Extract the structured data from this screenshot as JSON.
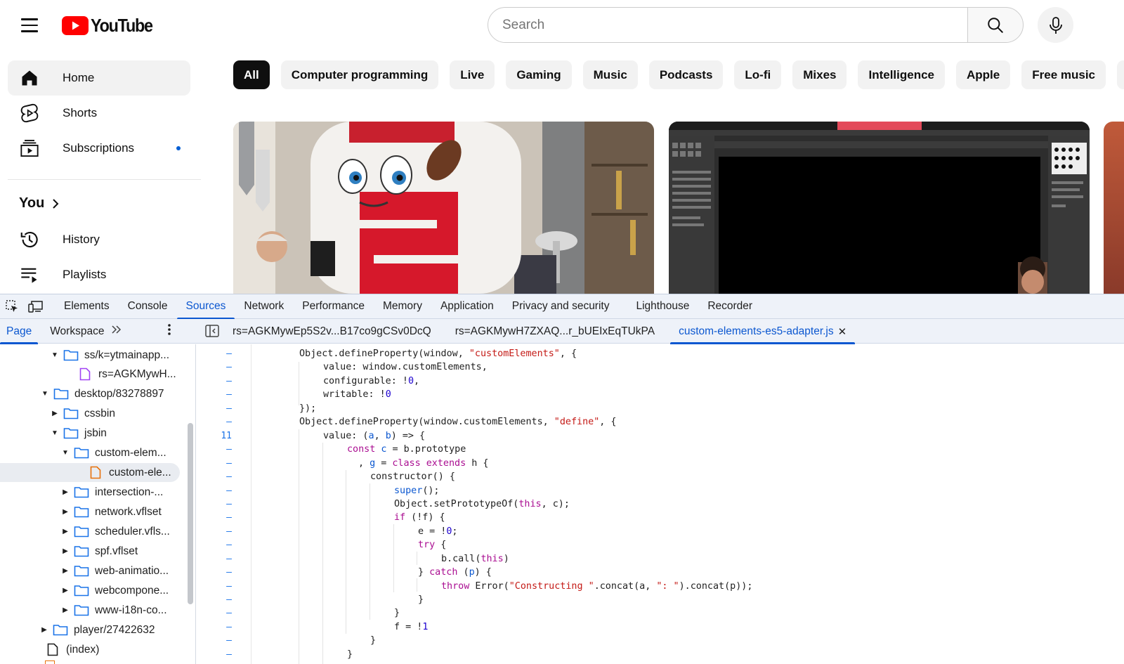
{
  "youtube": {
    "logo_text": "YouTube",
    "search": {
      "placeholder": "Search",
      "value": ""
    },
    "sidebar": {
      "items": [
        {
          "label": "Home",
          "icon": "home-icon",
          "active": true
        },
        {
          "label": "Shorts",
          "icon": "shorts-icon"
        },
        {
          "label": "Subscriptions",
          "icon": "subscriptions-icon"
        }
      ],
      "you_label": "You",
      "you_items": [
        {
          "label": "History",
          "icon": "history-icon"
        },
        {
          "label": "Playlists",
          "icon": "playlists-icon"
        }
      ]
    },
    "chips": [
      "All",
      "Computer programming",
      "Live",
      "Gaming",
      "Music",
      "Podcasts",
      "Lo-fi",
      "Mixes",
      "Intelligence",
      "Apple",
      "Free music",
      "B"
    ]
  },
  "devtools": {
    "tabs": [
      "Elements",
      "Console",
      "Sources",
      "Network",
      "Performance",
      "Memory",
      "Application",
      "Privacy and security",
      "Lighthouse",
      "Recorder"
    ],
    "active_tab": "Sources",
    "nav_tabs": [
      "Page",
      "Workspace"
    ],
    "file_tabs": [
      "rs=AGKMywEp5S2v...B17co9gCSv0DcQ",
      "rs=AGKMywH7ZXAQ...r_bUEIxEqTUkPA",
      "custom-elements-es5-adapter.js"
    ],
    "tree": [
      {
        "label": "ss/k=ytmainapp...",
        "type": "folder",
        "open": true
      },
      {
        "label": "rs=AGKMywH...",
        "type": "file-purple"
      },
      {
        "label": "desktop/83278897",
        "type": "folder",
        "open": true
      },
      {
        "label": "cssbin",
        "type": "folder",
        "open": false
      },
      {
        "label": "jsbin",
        "type": "folder",
        "open": true
      },
      {
        "label": "custom-elem...",
        "type": "folder",
        "open": true
      },
      {
        "label": "custom-ele...",
        "type": "file-orange",
        "selected": true
      },
      {
        "label": "intersection-...",
        "type": "folder",
        "open": false
      },
      {
        "label": "network.vflset",
        "type": "folder",
        "open": false
      },
      {
        "label": "scheduler.vfls...",
        "type": "folder",
        "open": false
      },
      {
        "label": "spf.vflset",
        "type": "folder",
        "open": false
      },
      {
        "label": "web-animatio...",
        "type": "folder",
        "open": false
      },
      {
        "label": "webcompone...",
        "type": "folder",
        "open": false
      },
      {
        "label": "www-i18n-co...",
        "type": "folder",
        "open": false
      },
      {
        "label": "player/27422632",
        "type": "folder",
        "open": false
      },
      {
        "label": "(index)",
        "type": "file"
      }
    ],
    "line_markers": [
      "–",
      "–",
      "–",
      "–",
      "–",
      "–",
      "11",
      "–",
      "–",
      "–",
      "–",
      "–",
      "–",
      "–",
      "–",
      "–",
      "–",
      "–",
      "–",
      "–",
      "–",
      "–",
      "–"
    ]
  }
}
